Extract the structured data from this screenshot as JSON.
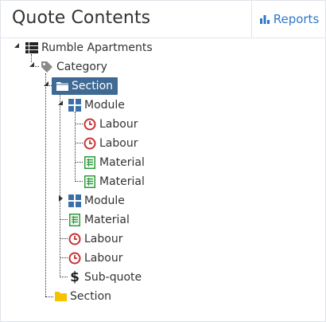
{
  "header": {
    "title": "Quote Contents",
    "reports_label": "Reports"
  },
  "tree": {
    "root": {
      "label": "Rumble Apartments",
      "icon": "list-icon"
    },
    "category": {
      "label": "Category",
      "icon": "tag-icon"
    },
    "section_selected": {
      "label": "Section",
      "icon": "folder-open-icon"
    },
    "module_1": {
      "label": "Module",
      "icon": "module-grid-icon"
    },
    "module_1_children": [
      {
        "label": "Labour",
        "icon": "clock-icon"
      },
      {
        "label": "Labour",
        "icon": "clock-icon"
      },
      {
        "label": "Material",
        "icon": "spreadsheet-icon"
      },
      {
        "label": "Material",
        "icon": "spreadsheet-icon"
      }
    ],
    "module_2": {
      "label": "Module",
      "icon": "module-grid-icon"
    },
    "section_children": [
      {
        "label": "Material",
        "icon": "spreadsheet-icon"
      },
      {
        "label": "Labour",
        "icon": "clock-icon"
      },
      {
        "label": "Labour",
        "icon": "clock-icon"
      },
      {
        "label": "Sub-quote",
        "icon": "dollar-icon"
      }
    ],
    "section_2": {
      "label": "Section",
      "icon": "folder-icon"
    }
  },
  "colors": {
    "accent": "#2e77c8",
    "selected_bg": "#3e6a93",
    "folder": "#f5c400",
    "module": "#3c6fa8",
    "clock": "#c83232",
    "spreadsheet": "#2e9a3a"
  }
}
